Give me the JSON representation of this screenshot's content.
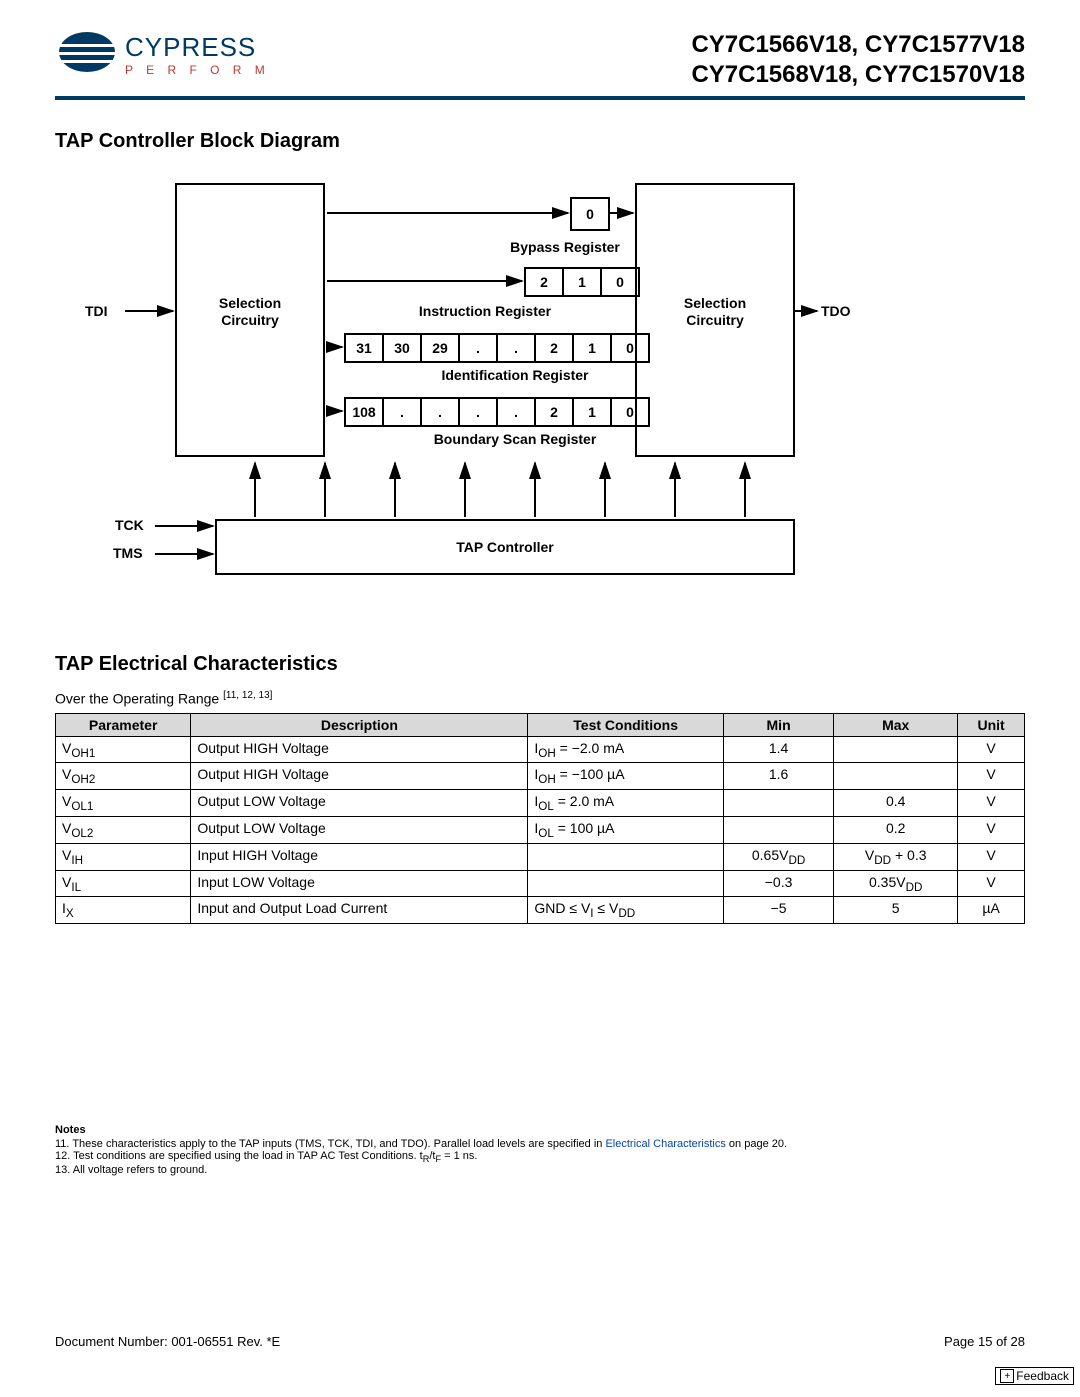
{
  "header": {
    "brand": "CYPRESS",
    "slogan": "P E R F O R M",
    "part_line1": "CY7C1566V18, CY7C1577V18",
    "part_line2": "CY7C1568V18, CY7C1570V18"
  },
  "section1_title": "TAP Controller Block Diagram",
  "diagram": {
    "sel_left": "Selection\nCircuitry",
    "sel_right": "Selection\nCircuitry",
    "tap_ctrl": "TAP Controller",
    "tdi": "TDI",
    "tdo": "TDO",
    "tck": "TCK",
    "tms": "TMS",
    "bypass_bit": "0",
    "bypass_label": "Bypass Register",
    "instruction_bits": [
      "2",
      "1",
      "0"
    ],
    "instruction_label": "Instruction Register",
    "id_bits": [
      "31",
      "30",
      "29",
      ".",
      ".",
      "2",
      "1",
      "0"
    ],
    "id_label": "Identification Register",
    "bsr_bits": [
      "108",
      ".",
      ".",
      ".",
      ".",
      "2",
      "1",
      "0"
    ],
    "bsr_label": "Boundary Scan Register"
  },
  "section2_title": "TAP Electrical Characteristics",
  "over_range": "Over the Operating Range ",
  "over_range_refs": "[11, 12, 13]",
  "table": {
    "headers": [
      "Parameter",
      "Description",
      "Test Conditions",
      "Min",
      "Max",
      "Unit"
    ],
    "rows": [
      {
        "param": "V<sub>OH1</sub>",
        "desc": "Output HIGH Voltage",
        "cond": "I<sub>OH</sub> = −2.0 mA",
        "min": "1.4",
        "max": "",
        "unit": "V"
      },
      {
        "param": "V<sub>OH2</sub>",
        "desc": "Output HIGH Voltage",
        "cond": "I<sub>OH</sub> = −100 µA",
        "min": "1.6",
        "max": "",
        "unit": "V"
      },
      {
        "param": "V<sub>OL1</sub>",
        "desc": "Output LOW Voltage",
        "cond": "I<sub>OL</sub> = 2.0 mA",
        "min": "",
        "max": "0.4",
        "unit": "V"
      },
      {
        "param": "V<sub>OL2</sub>",
        "desc": "Output LOW Voltage",
        "cond": "I<sub>OL</sub> = 100 µA",
        "min": "",
        "max": "0.2",
        "unit": "V"
      },
      {
        "param": "V<sub>IH</sub>",
        "desc": "Input HIGH Voltage",
        "cond": "",
        "min": "0.65V<sub>DD</sub>",
        "max": "V<sub>DD</sub> + 0.3",
        "unit": "V"
      },
      {
        "param": "V<sub>IL</sub>",
        "desc": "Input LOW Voltage",
        "cond": "",
        "min": "−0.3",
        "max": "0.35V<sub>DD</sub>",
        "unit": "V"
      },
      {
        "param": "I<sub>X</sub>",
        "desc": "Input and Output Load Current",
        "cond": "GND ≤ V<sub>I</sub> ≤ V<sub>DD</sub>",
        "min": "−5",
        "max": "5",
        "unit": "µA"
      }
    ]
  },
  "notes": {
    "title": "Notes",
    "items": [
      "11. These characteristics apply to the TAP inputs (TMS, TCK, TDI, and TDO). Parallel load levels are specified in <span class='link'>Electrical Characteristics</span> on page 20.",
      "12. Test conditions are specified using the load in TAP AC Test Conditions. t<sub>R</sub>/t<sub>F</sub> = 1 ns.",
      "13. All voltage refers to ground."
    ]
  },
  "footer": {
    "doc": "Document Number: 001-06551 Rev. *E",
    "page": "Page 15 of 28",
    "feedback": "Feedback"
  }
}
